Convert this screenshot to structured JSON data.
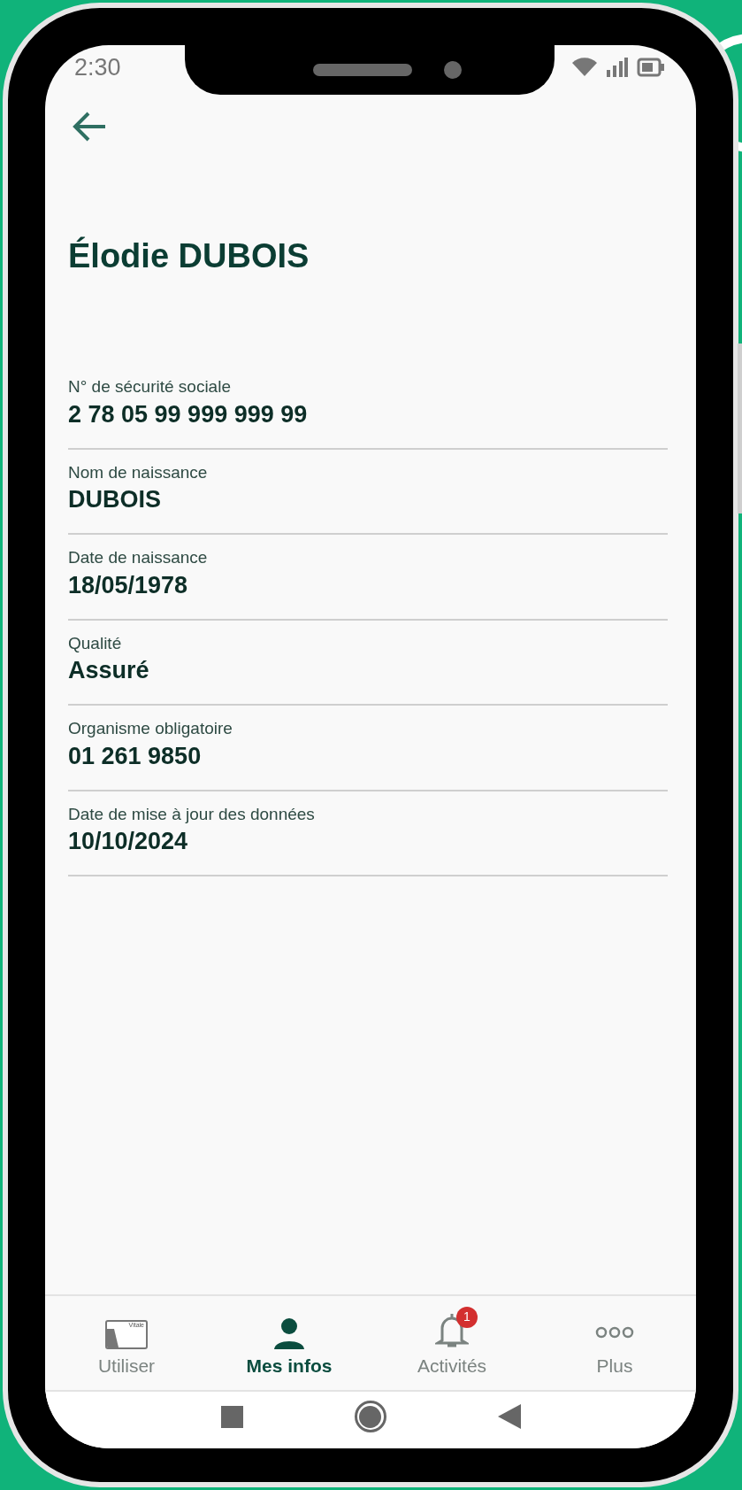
{
  "status_bar": {
    "time": "2:30"
  },
  "title": "Élodie DUBOIS",
  "fields": [
    {
      "label": "N° de sécurité sociale",
      "value": "2 78 05 99 999 999 99"
    },
    {
      "label": "Nom de naissance",
      "value": "DUBOIS"
    },
    {
      "label": "Date de naissance",
      "value": "18/05/1978"
    },
    {
      "label": "Qualité",
      "value": "Assuré"
    },
    {
      "label": "Organisme obligatoire",
      "value": "01 261 9850"
    },
    {
      "label": "Date de mise à jour des données",
      "value": "10/10/2024"
    }
  ],
  "bottom_nav": [
    {
      "kind": "card",
      "label": "Utiliser",
      "card_text": "Vitale",
      "selected": false
    },
    {
      "kind": "person",
      "label": "Mes infos",
      "selected": true
    },
    {
      "kind": "bell",
      "label": "Activités",
      "badge": "1",
      "selected": false
    },
    {
      "kind": "dots",
      "label": "Plus",
      "selected": false
    }
  ]
}
